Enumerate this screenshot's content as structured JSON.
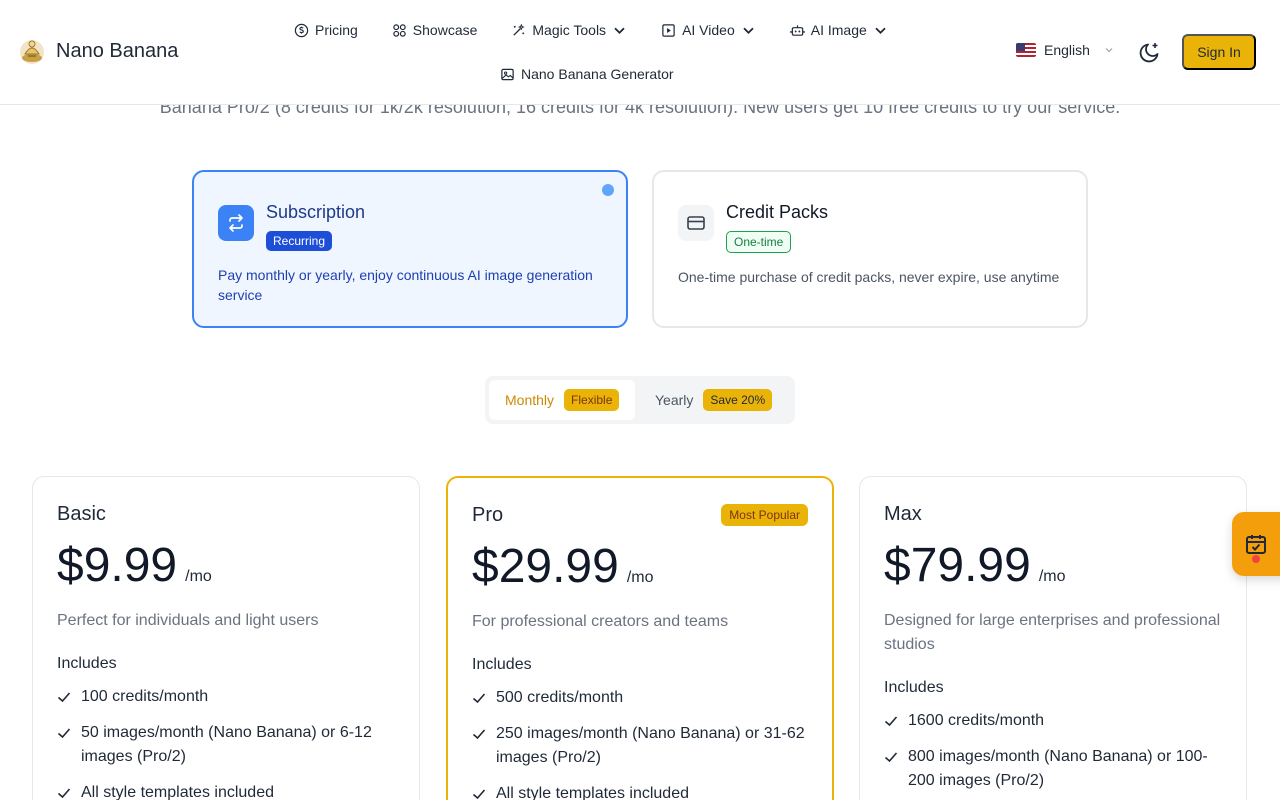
{
  "brand": {
    "name": "Nano Banana",
    "logo_icon": "banana-logo-icon"
  },
  "nav": {
    "items": [
      {
        "label": "Pricing",
        "icon": "coin-icon"
      },
      {
        "label": "Showcase",
        "icon": "grid-icon"
      },
      {
        "label": "Magic Tools",
        "icon": "magic-wand-icon",
        "dropdown": true
      },
      {
        "label": "AI Video",
        "icon": "video-icon",
        "dropdown": true
      },
      {
        "label": "AI Image",
        "icon": "robot-icon",
        "dropdown": true
      },
      {
        "label": "Nano Banana Generator",
        "icon": "image-icon"
      }
    ]
  },
  "language": {
    "label": "English",
    "flag": "us-flag-icon"
  },
  "header": {
    "signin_label": "Sign In",
    "theme_icon": "moon-sparkle-icon"
  },
  "intro": {
    "text": "Banana Pro/2 (8 credits for 1k/2k resolution, 16 credits for 4k resolution). New users get 10 free credits to try our service."
  },
  "plan_types": [
    {
      "title": "Subscription",
      "badge": "Recurring",
      "description": "Pay monthly or yearly, enjoy continuous AI image generation service",
      "icon": "repeat-icon",
      "selected": true
    },
    {
      "title": "Credit Packs",
      "badge": "One-time",
      "description": "One-time purchase of credit packs, never expire, use anytime",
      "icon": "credit-card-icon",
      "selected": false
    }
  ],
  "billing": {
    "monthly": {
      "label": "Monthly",
      "badge": "Flexible"
    },
    "yearly": {
      "label": "Yearly",
      "badge": "Save 20%"
    }
  },
  "plans": [
    {
      "name": "Basic",
      "price": "$9.99",
      "per": "/mo",
      "description": "Perfect for individuals and light users",
      "includes_label": "Includes",
      "features": [
        "100 credits/month",
        "50 images/month (Nano Banana) or 6-12 images (Pro/2)",
        "All style templates included"
      ]
    },
    {
      "name": "Pro",
      "price": "$29.99",
      "per": "/mo",
      "badge": "Most Popular",
      "description": "For professional creators and teams",
      "includes_label": "Includes",
      "features": [
        "500 credits/month",
        "250 images/month (Nano Banana) or 31-62 images (Pro/2)",
        "All style templates included"
      ]
    },
    {
      "name": "Max",
      "price": "$79.99",
      "per": "/mo",
      "description": "Designed for large enterprises and professional studios",
      "includes_label": "Includes",
      "features": [
        "1600 credits/month",
        "800 images/month (Nano Banana) or 100-200 images (Pro/2)"
      ]
    }
  ],
  "colors": {
    "accent": "#eab308",
    "selected_blue": "#3b82f6",
    "widget": "#f59e0b"
  },
  "floating_widget": {
    "icon": "calendar-check-icon"
  }
}
